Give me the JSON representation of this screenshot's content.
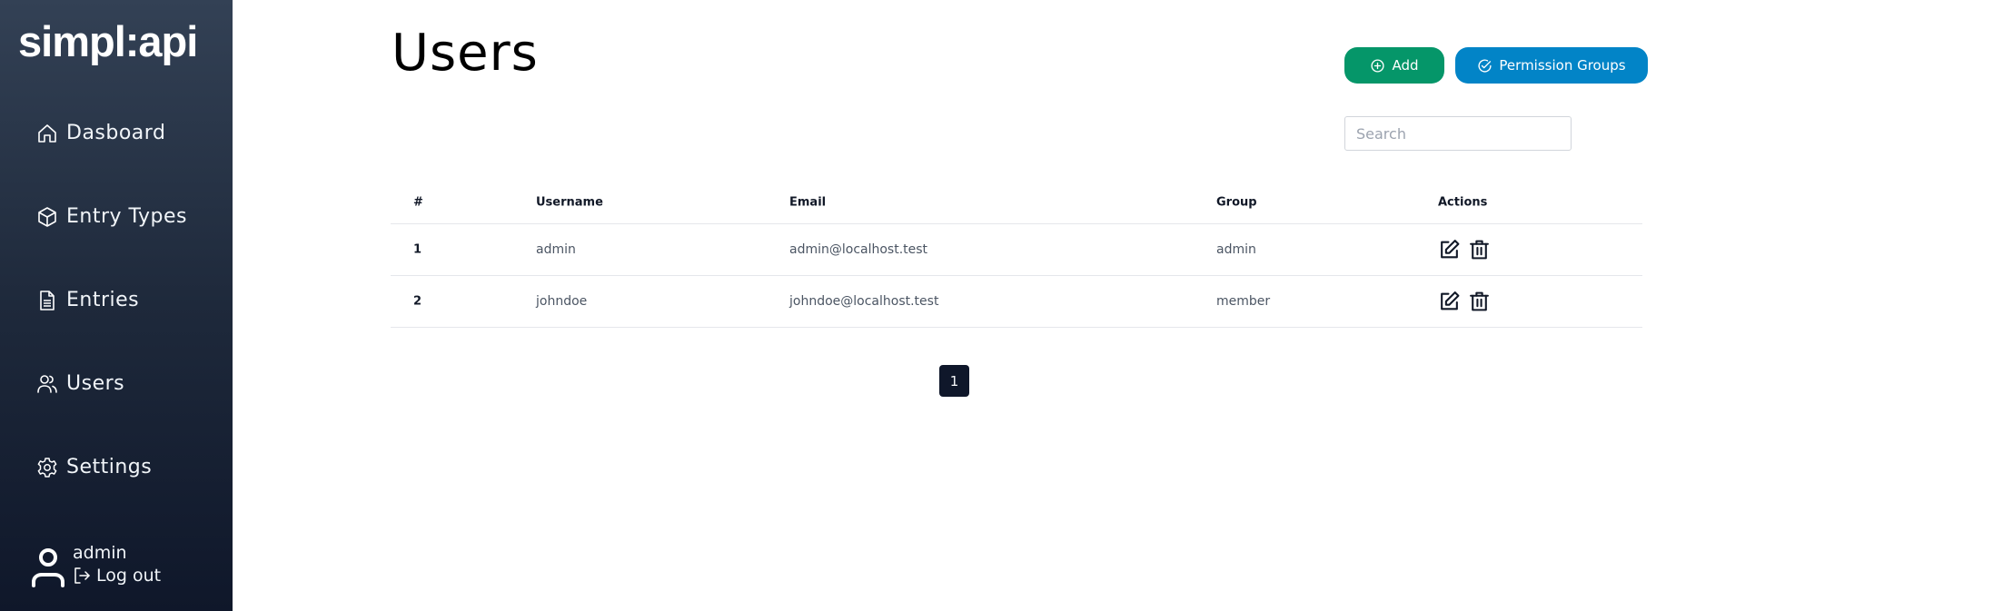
{
  "app": {
    "logo": "simpl:api"
  },
  "sidebar": {
    "items": [
      {
        "label": "Dasboard",
        "icon": "home-icon"
      },
      {
        "label": "Entry Types",
        "icon": "cube-icon"
      },
      {
        "label": "Entries",
        "icon": "document-icon"
      },
      {
        "label": "Users",
        "icon": "users-icon"
      },
      {
        "label": "Settings",
        "icon": "gear-icon"
      }
    ],
    "user": {
      "name": "admin",
      "logout_label": "Log out"
    }
  },
  "page": {
    "title": "Users"
  },
  "toolbar": {
    "add_label": "Add",
    "permission_groups_label": "Permission Groups",
    "search_placeholder": "Search",
    "search_value": ""
  },
  "table": {
    "columns": [
      "#",
      "Username",
      "Email",
      "Group",
      "Actions"
    ],
    "rows": [
      {
        "id": "1",
        "username": "admin",
        "email": "admin@localhost.test",
        "group": "admin"
      },
      {
        "id": "2",
        "username": "johndoe",
        "email": "johndoe@localhost.test",
        "group": "member"
      }
    ]
  },
  "pagination": {
    "current_page": "1"
  },
  "colors": {
    "sidebar_top": "#334155",
    "sidebar_bottom": "#0f172a",
    "add_button": "#059669",
    "permission_button": "#0284c7",
    "pager_active": "#0f172a"
  }
}
